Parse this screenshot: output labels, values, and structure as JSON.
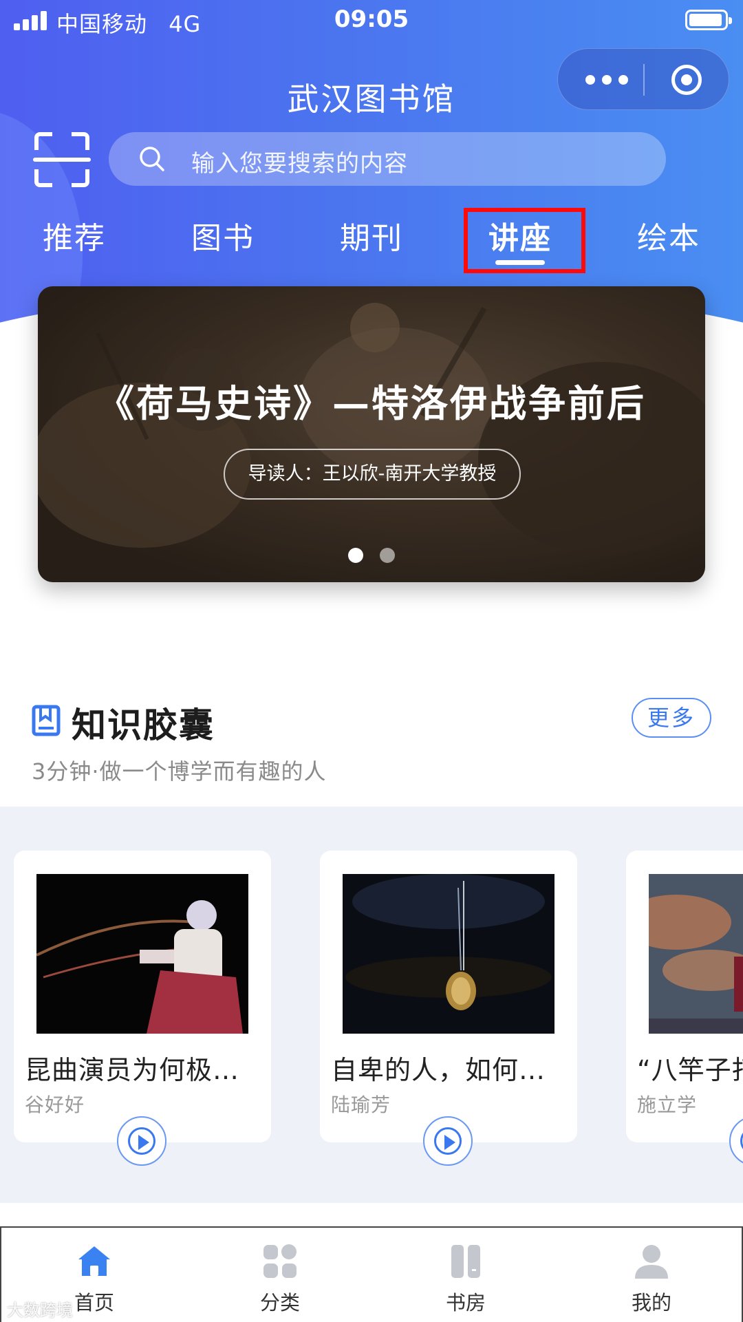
{
  "status_bar": {
    "carrier": "中国移动",
    "network": "4G",
    "time": "09:05"
  },
  "header": {
    "title": "武汉图书馆"
  },
  "search": {
    "placeholder": "输入您要搜索的内容"
  },
  "tabs": [
    {
      "label": "推荐",
      "active": false
    },
    {
      "label": "图书",
      "active": false
    },
    {
      "label": "期刊",
      "active": false
    },
    {
      "label": "讲座",
      "active": true
    },
    {
      "label": "绘本",
      "active": false
    }
  ],
  "banner": {
    "title": "《荷马史诗》—特洛伊战争前后",
    "subtitle": "导读人：王以欣-南开大学教授",
    "slide_count": 2,
    "active_slide": 1
  },
  "section": {
    "title": "知识胶囊",
    "subtitle": "3分钟·做一个博学而有趣的人",
    "more_label": "更多"
  },
  "cards": [
    {
      "title": "昆曲演员为何极…",
      "author": "谷好好"
    },
    {
      "title": "自卑的人，如何…",
      "author": "陆瑜芳"
    },
    {
      "title": "“八竿子打",
      "author": "施立学"
    }
  ],
  "bottom_nav": [
    {
      "label": "首页",
      "icon": "home-icon",
      "active": true
    },
    {
      "label": "分类",
      "icon": "category-icon",
      "active": false
    },
    {
      "label": "书房",
      "icon": "bookshelf-icon",
      "active": false
    },
    {
      "label": "我的",
      "icon": "profile-icon",
      "active": false
    }
  ],
  "watermark": "大数跨境",
  "colors": {
    "accent": "#3a78f0",
    "highlight": "#ff0a0a",
    "gradient_start": "#4f5ff0",
    "gradient_end": "#4a8ef2"
  }
}
